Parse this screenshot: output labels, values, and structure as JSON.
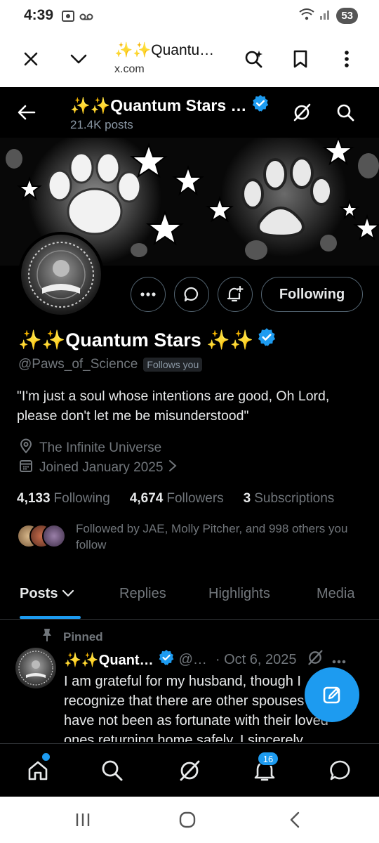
{
  "status_bar": {
    "time": "4:39",
    "battery": "53"
  },
  "browser": {
    "page_title": "✨✨Quantu…",
    "domain": "x.com"
  },
  "header": {
    "name": "✨✨Quantum Stars …",
    "posts_count": "21.4K posts"
  },
  "profile": {
    "display_name": "✨✨Quantum Stars ✨✨",
    "handle": "@Paws_of_Science",
    "follows_you": "Follows you",
    "bio": "\"I'm just a soul whose intentions are good, Oh Lord, please don't let me be misunderstood\"",
    "location": "The Infinite Universe",
    "joined": "Joined January 2025",
    "following_count": "4,133",
    "following_label": "Following",
    "followers_count": "4,674",
    "followers_label": "Followers",
    "subscriptions_count": "3",
    "subscriptions_label": "Subscriptions",
    "followed_by": "Followed by JAE, Molly Pitcher, and 998 others you follow",
    "following_button": "Following"
  },
  "tabs": [
    {
      "label": "Posts"
    },
    {
      "label": "Replies"
    },
    {
      "label": "Highlights"
    },
    {
      "label": "Media"
    }
  ],
  "post": {
    "pinned_label": "Pinned",
    "author": "✨✨Quant…",
    "handle": "@…",
    "date": "· Oct 6, 2025",
    "text": "I am grateful for my husband, though I recognize that there are other spouses who have not been as fortunate with their loved ones returning home safely. I sincerely"
  },
  "bottom_nav": {
    "notifications_badge": "16"
  },
  "colors": {
    "accent": "#1d9bf0",
    "background": "#000000",
    "muted_text": "#71767b"
  }
}
